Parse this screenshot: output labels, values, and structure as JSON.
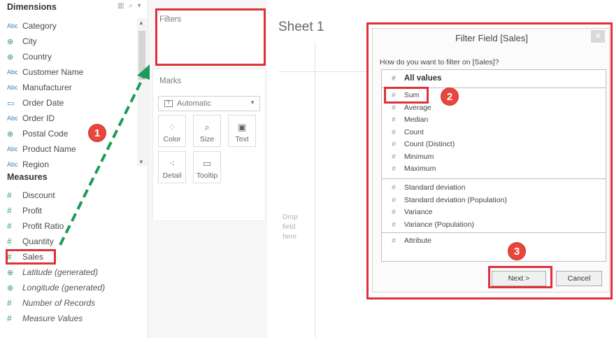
{
  "data_pane": {
    "dimensions_title": "Dimensions",
    "dimensions": [
      {
        "icon": "abc-icon",
        "type_label": "Abc",
        "name": "Category"
      },
      {
        "icon": "globe-icon",
        "type_label": "⊕",
        "name": "City"
      },
      {
        "icon": "globe-icon",
        "type_label": "⊕",
        "name": "Country"
      },
      {
        "icon": "abc-icon",
        "type_label": "Abc",
        "name": "Customer Name"
      },
      {
        "icon": "abc-icon",
        "type_label": "Abc",
        "name": "Manufacturer"
      },
      {
        "icon": "calendar-icon",
        "type_label": "▭",
        "name": "Order Date"
      },
      {
        "icon": "abc-icon",
        "type_label": "Abc",
        "name": "Order ID"
      },
      {
        "icon": "globe-icon",
        "type_label": "⊕",
        "name": "Postal Code"
      },
      {
        "icon": "abc-icon",
        "type_label": "Abc",
        "name": "Product Name"
      },
      {
        "icon": "abc-icon",
        "type_label": "Abc",
        "name": "Region"
      }
    ],
    "measures_title": "Measures",
    "measures": [
      {
        "icon": "hash-icon",
        "type_label": "#",
        "name": "Discount",
        "italic": false
      },
      {
        "icon": "hash-icon",
        "type_label": "#",
        "name": "Profit",
        "italic": false
      },
      {
        "icon": "hash-icon",
        "type_label": "#",
        "name": "Profit Ratio",
        "italic": false
      },
      {
        "icon": "hash-icon",
        "type_label": "#",
        "name": "Quantity",
        "italic": false
      },
      {
        "icon": "hash-icon",
        "type_label": "#",
        "name": "Sales",
        "italic": false
      },
      {
        "icon": "globe-icon",
        "type_label": "⊕",
        "name": "Latitude (generated)",
        "italic": true
      },
      {
        "icon": "globe-icon",
        "type_label": "⊕",
        "name": "Longitude (generated)",
        "italic": true
      },
      {
        "icon": "hash-icon",
        "type_label": "#",
        "name": "Number of Records",
        "italic": true
      },
      {
        "icon": "hash-icon",
        "type_label": "#",
        "name": "Measure Values",
        "italic": true
      }
    ]
  },
  "filters": {
    "label": "Filters"
  },
  "marks": {
    "label": "Marks",
    "mark_type": "Automatic",
    "buttons": [
      {
        "name": "color",
        "label": "Color",
        "icon": "color-dots-icon"
      },
      {
        "name": "size",
        "label": "Size",
        "icon": "size-icon"
      },
      {
        "name": "text",
        "label": "Text",
        "icon": "text-icon"
      },
      {
        "name": "detail",
        "label": "Detail",
        "icon": "detail-icon"
      },
      {
        "name": "tooltip",
        "label": "Tooltip",
        "icon": "tooltip-icon"
      }
    ]
  },
  "sheet": {
    "title": "Sheet 1",
    "drop_hint_lines": [
      "Drop",
      "field",
      "here"
    ]
  },
  "dialog": {
    "title": "Filter Field [Sales]",
    "question": "How do you want to filter on [Sales]?",
    "header_option": "All values",
    "group1": [
      "Sum",
      "Average",
      "Median",
      "Count",
      "Count (Distinct)",
      "Minimum",
      "Maximum"
    ],
    "group2": [
      "Standard deviation",
      "Standard deviation (Population)",
      "Variance",
      "Variance (Population)"
    ],
    "group3": [
      "Attribute"
    ],
    "next_label": "Next >",
    "cancel_label": "Cancel"
  },
  "annotations": {
    "step1": "1",
    "step2": "2",
    "step3": "3"
  },
  "colors": {
    "highlight": "#e0303a",
    "badge": "#e8453c",
    "arrow": "#1f9a5a"
  }
}
